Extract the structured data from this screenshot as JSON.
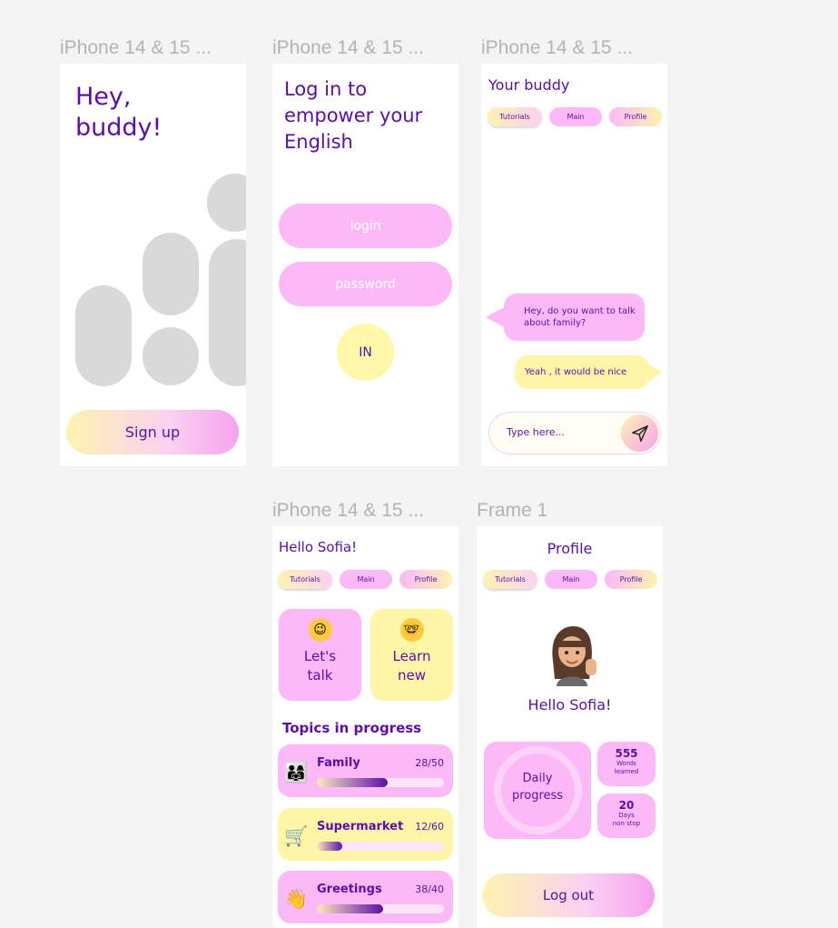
{
  "frames": {
    "welcome": {
      "label": "iPhone 14 & 15 ...",
      "greeting": "Hey,\nbuddy!",
      "signup_label": "Sign up"
    },
    "login": {
      "label": "iPhone 14 & 15 ...",
      "title": "Log in to\nempower your\nEnglish",
      "login_placeholder": "login",
      "password_placeholder": "password",
      "in_label": "IN"
    },
    "chat": {
      "label": "iPhone 14 & 15 ...",
      "title": "Your buddy",
      "tabs": [
        "Tutorials",
        "Main",
        "Profile"
      ],
      "message_bot": "Hey, do you want to talk about family?",
      "message_user": "Yeah , it would be nice",
      "input_placeholder": "Type here..."
    },
    "main": {
      "label": "iPhone 14 & 15 ...",
      "title": "Hello Sofia!",
      "tabs": [
        "Tutorials",
        "Main",
        "Profile"
      ],
      "cards": [
        {
          "label": "Let's\ntalk",
          "icon": "winking-face-icon"
        },
        {
          "label": "Learn\nnew",
          "icon": "nerd-face-icon"
        }
      ],
      "section_title": "Topics in progress",
      "topics": [
        {
          "name": "Family",
          "count": "28/50",
          "progress": 0.56,
          "icon": "family-icon"
        },
        {
          "name": "Supermarket",
          "count": "12/60",
          "progress": 0.2,
          "icon": "shopping-cart-icon"
        },
        {
          "name": "Greetings",
          "count": "38/40",
          "progress": 0.52,
          "icon": "waving-hand-icon"
        }
      ]
    },
    "profile": {
      "label": "Frame 1",
      "title": "Profile",
      "tabs": [
        "Tutorials",
        "Main",
        "Profile"
      ],
      "hello": "Hello Sofia!",
      "daily_label": "Daily\nprogress",
      "stats": [
        {
          "value": "555",
          "caption": "Words\nlearned"
        },
        {
          "value": "20",
          "caption": "Days\nnon stop"
        }
      ],
      "logout_label": "Log out"
    }
  },
  "colors": {
    "accent": "#5b0fa8",
    "pink": "#fbb9f7",
    "yellow": "#fff5a6",
    "placeholder": "#d9d9d9"
  }
}
